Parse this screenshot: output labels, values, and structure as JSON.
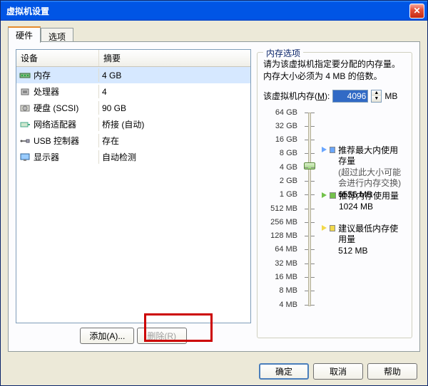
{
  "window": {
    "title": "虚拟机设置"
  },
  "tabs": {
    "hardware": "硬件",
    "options": "选项"
  },
  "list": {
    "header_device": "设备",
    "header_summary": "摘要",
    "rows": [
      {
        "name": "内存",
        "summary": "4 GB",
        "icon": "memory"
      },
      {
        "name": "处理器",
        "summary": "4",
        "icon": "cpu"
      },
      {
        "name": "硬盘 (SCSI)",
        "summary": "90 GB",
        "icon": "disk"
      },
      {
        "name": "网络适配器",
        "summary": "桥接 (自动)",
        "icon": "nic"
      },
      {
        "name": "USB 控制器",
        "summary": "存在",
        "icon": "usb"
      },
      {
        "name": "显示器",
        "summary": "自动检测",
        "icon": "display"
      }
    ]
  },
  "left_buttons": {
    "add": "添加(A)...",
    "remove": "删除(R)"
  },
  "right": {
    "group_title": "内存选项",
    "desc": "请为该虚拟机指定要分配的内存量。内存大小必须为 4 MB 的倍数。",
    "mem_label_pre": "该虚拟机内存(",
    "mem_label_key": "M",
    "mem_label_post": "):",
    "mem_value": "4096",
    "mem_unit": "MB",
    "ticks": [
      "64 GB",
      "32 GB",
      "16 GB",
      "8 GB",
      "4 GB",
      "2 GB",
      "1 GB",
      "512 MB",
      "256 MB",
      "128 MB",
      "64 MB",
      "32 MB",
      "16 MB",
      "8 MB",
      "4 MB"
    ],
    "markers": {
      "max": {
        "label": "推荐最大内使用存量",
        "sub1": "(超过此大小可能",
        "sub2": "会进行内存交换)",
        "value": "6556 MB",
        "color": "#6aa6ff"
      },
      "rec": {
        "label": "推荐内存使用量",
        "value": "1024 MB",
        "color": "#73c24b"
      },
      "min": {
        "label": "建议最低内存使用量",
        "value": "512 MB",
        "color": "#f2d94b"
      }
    }
  },
  "bottom": {
    "ok": "确定",
    "cancel": "取消",
    "help": "帮助"
  }
}
